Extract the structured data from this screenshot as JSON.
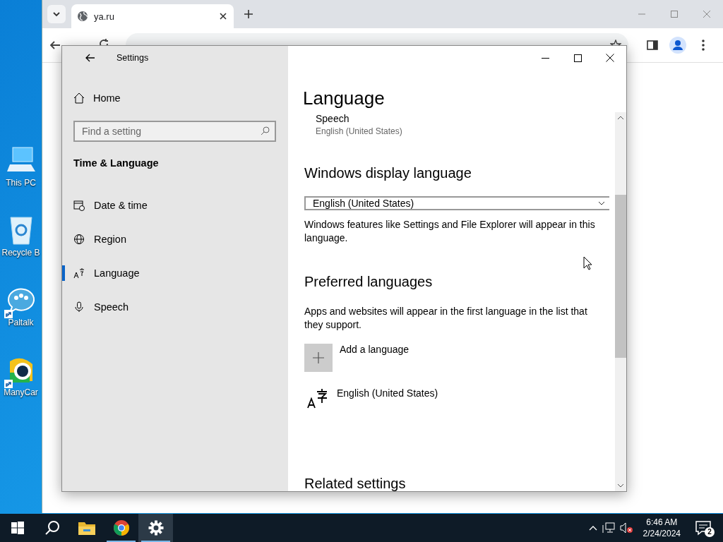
{
  "desktop": {
    "icons": [
      {
        "kind": "computer",
        "label": "This PC",
        "shortcut": false
      },
      {
        "kind": "recycle-bin",
        "label": "Recycle B",
        "shortcut": false
      },
      {
        "kind": "chat",
        "label": "Paltalk",
        "shortcut": true
      },
      {
        "kind": "camera",
        "label": "ManyCar",
        "shortcut": true
      }
    ]
  },
  "browser": {
    "tabs": [
      {
        "title": "ya.ru",
        "selected": true
      }
    ]
  },
  "settings": {
    "title": "Settings",
    "home": "Home",
    "search": {
      "placeholder": "Find a setting"
    },
    "section": "Time & Language",
    "nav": [
      {
        "kind": "clock",
        "label": "Date & time",
        "selected": false
      },
      {
        "kind": "globe",
        "label": "Region",
        "selected": false
      },
      {
        "kind": "language",
        "label": "Language",
        "selected": true
      },
      {
        "kind": "microphone",
        "label": "Speech",
        "selected": false
      }
    ],
    "page": {
      "title": "Language",
      "speech": {
        "label": "Speech",
        "value": "English (United States)"
      },
      "display_language": {
        "heading": "Windows display language",
        "dropdown": "English (United States)",
        "description": "Windows features like Settings and File Explorer will appear in this language."
      },
      "preferred": {
        "heading": "Preferred languages",
        "description": "Apps and websites will appear in the first language in the list that they support.",
        "add": "Add a language",
        "languages": [
          {
            "name": "English (United States)"
          }
        ]
      },
      "related_heading": "Related settings"
    }
  },
  "taskbar": {
    "apps": [
      {
        "kind": "start",
        "running": false,
        "selected": false
      },
      {
        "kind": "search",
        "running": false,
        "selected": false
      },
      {
        "kind": "folder",
        "running": false,
        "selected": false
      },
      {
        "kind": "chrome",
        "running": true,
        "selected": false
      },
      {
        "kind": "settings",
        "running": true,
        "selected": true
      }
    ],
    "clock": {
      "time": "6:46 AM",
      "date": "2/24/2024"
    },
    "notifications": "2"
  }
}
